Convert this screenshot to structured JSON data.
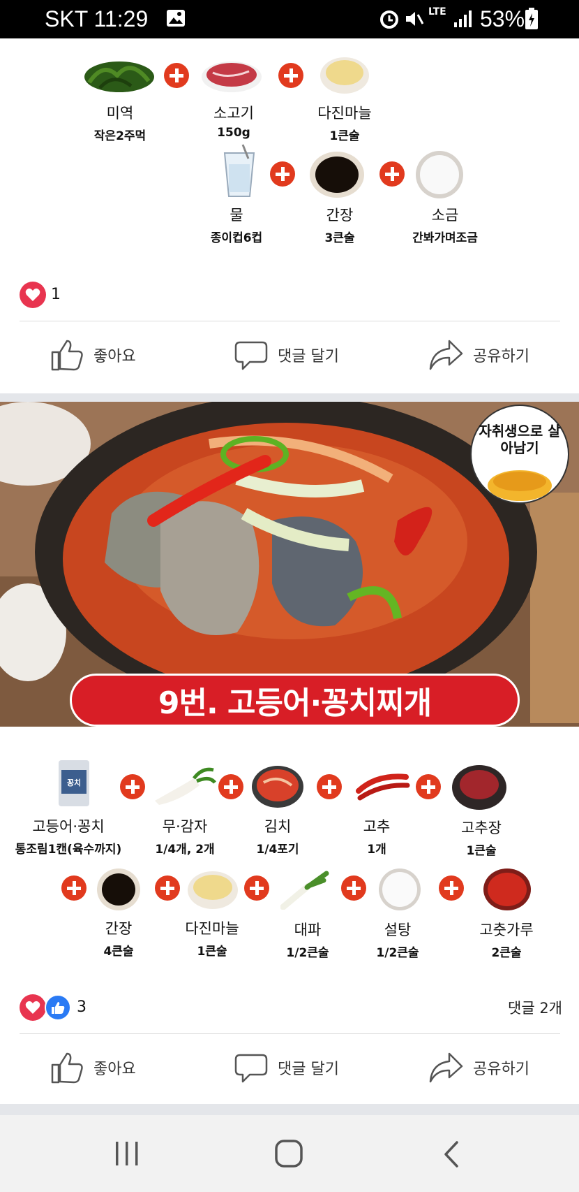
{
  "status_bar": {
    "carrier_time": "SKT 11:29",
    "network": "LTE",
    "battery": "53%"
  },
  "post1": {
    "ingredients_row1": [
      {
        "name": "미역",
        "amount": "작은2주먹"
      },
      {
        "name": "소고기",
        "amount": "150g"
      },
      {
        "name": "다진마늘",
        "amount": "1큰술"
      }
    ],
    "ingredients_row2": [
      {
        "name": "물",
        "amount": "종이컵6컵"
      },
      {
        "name": "간장",
        "amount": "3큰술"
      },
      {
        "name": "소금",
        "amount": "간봐가며조금"
      }
    ],
    "reaction_count": "1",
    "actions": {
      "like": "좋아요",
      "comment": "댓글 달기",
      "share": "공유하기"
    }
  },
  "post2": {
    "badge": "자취생으로 살아남기",
    "title": "9번. 고등어·꽁치찌개",
    "can_label": "꽁치",
    "ingredients_row1": [
      {
        "name": "고등어·꽁치",
        "amount": "통조림1캔(육수까지)"
      },
      {
        "name": "무·감자",
        "amount": "1/4개, 2개"
      },
      {
        "name": "김치",
        "amount": "1/4포기"
      },
      {
        "name": "고추",
        "amount": "1개"
      },
      {
        "name": "고추장",
        "amount": "1큰술"
      }
    ],
    "ingredients_row2": [
      {
        "name": "간장",
        "amount": "4큰술"
      },
      {
        "name": "다진마늘",
        "amount": "1큰술"
      },
      {
        "name": "대파",
        "amount": "1/2큰술"
      },
      {
        "name": "설탕",
        "amount": "1/2큰술"
      },
      {
        "name": "고춧가루",
        "amount": "2큰술"
      }
    ],
    "reaction_count": "3",
    "comments": "댓글 2개",
    "actions": {
      "like": "좋아요",
      "comment": "댓글 달기",
      "share": "공유하기"
    }
  },
  "colors": {
    "plus": "#e13a1e",
    "heart": "#e8344f",
    "like": "#2a7af4",
    "title_banner": "#d81e26"
  }
}
